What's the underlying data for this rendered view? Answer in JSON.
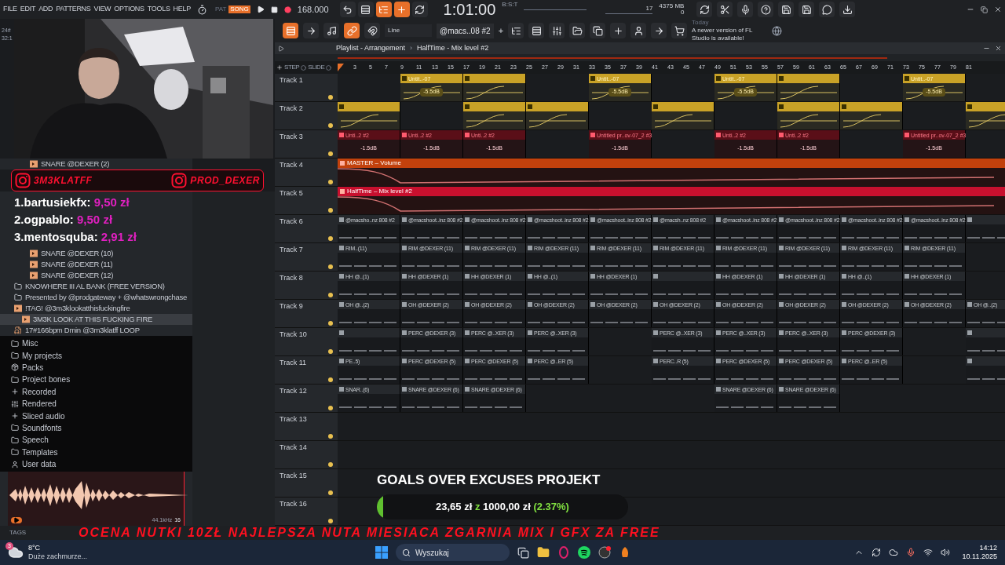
{
  "menu": [
    "FILE",
    "EDIT",
    "ADD",
    "PATTERNS",
    "VIEW",
    "OPTIONS",
    "TOOLS",
    "HELP"
  ],
  "transport": {
    "modes": [
      {
        "label": "PAT",
        "selected": false
      },
      {
        "label": "SONG",
        "selected": true
      }
    ],
    "tempo": "168.000",
    "time": "1:01:00",
    "time_unit": "B:S:T"
  },
  "monitor": {
    "cpu": "17",
    "memory": "4375 MB",
    "polyphony": "0"
  },
  "hint_lines": [
    "24#",
    "32:1"
  ],
  "toolbar": {
    "snap": "Line",
    "pattern": "@macs..08 #2",
    "add": "+",
    "news_day": "Today",
    "news": "A newer version of FL Studio is available!"
  },
  "webcam": {
    "kind": "picture"
  },
  "socials": [
    {
      "handle": "3M3KLATFF"
    },
    {
      "handle": "PROD_DEXER"
    }
  ],
  "donors": [
    {
      "rank": "1.",
      "name": "bartusiekfx:",
      "amount": "9,50 zł"
    },
    {
      "rank": "2.",
      "name": "ogpablo:",
      "amount": "9,50 zł"
    },
    {
      "rank": "3.",
      "name": "mentosquba:",
      "amount": "2,91 zł"
    }
  ],
  "browser": {
    "open_items": [
      {
        "label": "SNARE @DEXER (2)",
        "kind": "sample",
        "selected": false
      },
      {
        "label": "SNARE @DEXER (10)",
        "kind": "sample",
        "selected": false
      },
      {
        "label": "SNARE @DEXER (11)",
        "kind": "sample",
        "selected": false
      },
      {
        "label": "SNARE @DEXER (12)",
        "kind": "sample",
        "selected": false
      },
      {
        "label": "KNOWHERE III AL BANK (FREE VERSION)",
        "kind": "folder",
        "selected": false
      },
      {
        "label": "Presented by @prodgateway + @whatswrongchase",
        "kind": "folder",
        "selected": false
      },
      {
        "label": "!TAG! @3m3klookatthisfuckingfire",
        "kind": "sample",
        "selected": false,
        "children": [
          {
            "label": "3M3K LOOK AT THIS FUCKING FIRE",
            "kind": "sample",
            "selected": true
          }
        ]
      },
      {
        "label": "17#166bpm Dmin @3m3klatff LOOP",
        "kind": "audio",
        "selected": false
      }
    ],
    "roots": [
      {
        "label": "Misc",
        "kind": "folder"
      },
      {
        "label": "My projects",
        "kind": "folder"
      },
      {
        "label": "Packs",
        "kind": "packs"
      },
      {
        "label": "Project bones",
        "kind": "folder"
      },
      {
        "label": "Recorded",
        "kind": "recorded"
      },
      {
        "label": "Rendered",
        "kind": "rendered"
      },
      {
        "label": "Sliced audio",
        "kind": "recorded"
      },
      {
        "label": "Soundfonts",
        "kind": "folder"
      },
      {
        "label": "Speech",
        "kind": "folder"
      },
      {
        "label": "Templates",
        "kind": "folder"
      },
      {
        "label": "User data",
        "kind": "user"
      }
    ],
    "sample_rate": "44.1kHz",
    "bit_depth": "16",
    "tags_label": "TAGS"
  },
  "playlist": {
    "title": "Playlist - Arrangement",
    "separator": "›",
    "pattern": "HalfTime - Mix level #2",
    "step_label": "STEP",
    "slide_label": "SLIDE",
    "ruler": [
      "3",
      "5",
      "7",
      "9",
      "11",
      "13",
      "15",
      "17",
      "19",
      "21",
      "23",
      "25",
      "27",
      "29",
      "31",
      "33",
      "35",
      "37",
      "39",
      "41",
      "43",
      "45",
      "47",
      "49",
      "51",
      "53",
      "55",
      "57",
      "59",
      "61",
      "63",
      "65",
      "67",
      "69",
      "71",
      "73",
      "75",
      "77",
      "79",
      "81"
    ],
    "tracks": [
      {
        "name": "Track 1",
        "clips": [
          {
            "kind": "gap"
          },
          {
            "kind": "melody",
            "label": "Untit..-07",
            "note": "-5.5dB"
          },
          {
            "kind": "melody"
          },
          {
            "kind": "gap"
          },
          {
            "kind": "melody",
            "label": "Untit..-07",
            "note": "-5.5dB"
          },
          {
            "kind": "gap"
          },
          {
            "kind": "melody",
            "label": "Untit..-07",
            "note": "-5.5dB"
          },
          {
            "kind": "melody"
          },
          {
            "kind": "gap"
          },
          {
            "kind": "melody",
            "label": "Untit..-07",
            "note": "-5.5dB"
          }
        ]
      },
      {
        "name": "Track 2",
        "clips": [
          {
            "kind": "melody"
          },
          {
            "kind": "gap"
          },
          {
            "kind": "melody"
          },
          {
            "kind": "melody"
          },
          {
            "kind": "gap"
          },
          {
            "kind": "melody"
          },
          {
            "kind": "gap"
          },
          {
            "kind": "melody"
          },
          {
            "kind": "melody"
          },
          {
            "kind": "gap"
          },
          {
            "kind": "melody"
          }
        ]
      },
      {
        "name": "Track 3",
        "clips": [
          {
            "kind": "audio",
            "label": "Unti..2 #2",
            "note": "-1.5dB"
          },
          {
            "kind": "audio",
            "label": "Unti..2 #2",
            "note": "-1.5dB"
          },
          {
            "kind": "audio",
            "label": "Unti..2 #2",
            "note": "-1.5dB"
          },
          {
            "kind": "gap"
          },
          {
            "kind": "audio",
            "label": "Untitled pr..ov-07_2 #3",
            "note": "-1.5dB"
          },
          {
            "kind": "gap"
          },
          {
            "kind": "audio",
            "label": "Unti..2 #2",
            "note": "-1.5dB"
          },
          {
            "kind": "audio",
            "label": "Unti..2 #2",
            "note": "-1.5dB"
          },
          {
            "kind": "gap"
          },
          {
            "kind": "audio",
            "label": "Untitled pr..ov-07_2 #3",
            "note": "-1.5dB"
          }
        ]
      },
      {
        "name": "Track 4",
        "clips": [
          {
            "kind": "automation",
            "label": "MASTER – Volume",
            "color": "#c2410c"
          }
        ]
      },
      {
        "name": "Track 5",
        "clips": [
          {
            "kind": "automation",
            "label": "HalfTime – Mix level #2",
            "color": "#c8102e"
          }
        ]
      },
      {
        "name": "Track 6",
        "clips": [
          {
            "kind": "drums",
            "label": "@macsho..nz 808 #2"
          },
          {
            "kind": "drums",
            "label": "@macshoot..inz 808 #2"
          },
          {
            "kind": "drums",
            "label": "@macshoot..inz 808 #2"
          },
          {
            "kind": "drums",
            "label": "@macshoot..inz 808 #2"
          },
          {
            "kind": "drums",
            "label": "@macshoot..inz 808 #2"
          },
          {
            "kind": "drums",
            "label": "@macsh..nz 808 #2"
          },
          {
            "kind": "drums",
            "label": "@macshoot..inz 808 #2"
          },
          {
            "kind": "drums",
            "label": "@macshoot..inz 808 #2"
          },
          {
            "kind": "drums",
            "label": "@macshoot..inz 808 #2"
          },
          {
            "kind": "drums",
            "label": "@macshoot..inz 808 #2"
          },
          {
            "kind": "drums"
          }
        ]
      },
      {
        "name": "Track 7",
        "clips": [
          {
            "kind": "drums",
            "label": "RIM..(11)"
          },
          {
            "kind": "drums",
            "label": "RIM @DEXER (11)"
          },
          {
            "kind": "drums",
            "label": "RIM @DEXER (11)"
          },
          {
            "kind": "drums",
            "label": "RIM @DEXER (11)"
          },
          {
            "kind": "drums",
            "label": "RIM @DEXER (11)"
          },
          {
            "kind": "drums",
            "label": "RIM @DEXER (11)"
          },
          {
            "kind": "drums",
            "label": "RIM @DEXER (11)"
          },
          {
            "kind": "drums",
            "label": "RIM @DEXER (11)"
          },
          {
            "kind": "drums",
            "label": "RIM @DEXER (11)"
          },
          {
            "kind": "drums",
            "label": "RIM @DEXER (11)"
          }
        ]
      },
      {
        "name": "Track 8",
        "clips": [
          {
            "kind": "drums",
            "label": "HH @..(1)"
          },
          {
            "kind": "drums",
            "label": "HH @DEXER (1)"
          },
          {
            "kind": "drums",
            "label": "HH @DEXER (1)"
          },
          {
            "kind": "drums",
            "label": "HH @..(1)"
          },
          {
            "kind": "drums",
            "label": "HH @DEXER (1)"
          },
          {
            "kind": "drums"
          },
          {
            "kind": "drums",
            "label": "HH @DEXER (1)"
          },
          {
            "kind": "drums",
            "label": "HH @DEXER (1)"
          },
          {
            "kind": "drums",
            "label": "HH @..(1)"
          },
          {
            "kind": "drums",
            "label": "HH @DEXER (1)"
          }
        ]
      },
      {
        "name": "Track 9",
        "clips": [
          {
            "kind": "drums",
            "label": "OH @..(2)"
          },
          {
            "kind": "drums",
            "label": "OH @DEXER (2)"
          },
          {
            "kind": "drums",
            "label": "OH @DEXER (2)"
          },
          {
            "kind": "drums",
            "label": "OH @DEXER (2)"
          },
          {
            "kind": "drums",
            "label": "OH @DEXER (2)"
          },
          {
            "kind": "drums",
            "label": "OH @DEXER (2)"
          },
          {
            "kind": "drums",
            "label": "OH @DEXER (2)"
          },
          {
            "kind": "drums",
            "label": "OH @DEXER (2)"
          },
          {
            "kind": "drums",
            "label": "OH @DEXER (2)"
          },
          {
            "kind": "drums",
            "label": "OH @DEXER (2)"
          },
          {
            "kind": "drums",
            "label": "OH @..(2)"
          }
        ]
      },
      {
        "name": "Track 10",
        "clips": [
          {
            "kind": "drums"
          },
          {
            "kind": "drums",
            "label": "PERC @DEXER (3)"
          },
          {
            "kind": "drums",
            "label": "PERC @..XER (3)"
          },
          {
            "kind": "drums",
            "label": "PERC @..XER (3)"
          },
          {
            "kind": "gap"
          },
          {
            "kind": "drums",
            "label": "PERC @..XER (3)"
          },
          {
            "kind": "drums",
            "label": "PERC @..XER (3)"
          },
          {
            "kind": "drums",
            "label": "PERC @..XER (3)"
          },
          {
            "kind": "drums",
            "label": "PERC @DEXER (3)"
          },
          {
            "kind": "gap"
          },
          {
            "kind": "drums"
          }
        ]
      },
      {
        "name": "Track 11",
        "clips": [
          {
            "kind": "drums",
            "label": "PE..5)"
          },
          {
            "kind": "drums",
            "label": "PERC @DEXER (5)"
          },
          {
            "kind": "drums",
            "label": "PERC @DEXER (5)"
          },
          {
            "kind": "drums",
            "label": "PERC @..ER (5)"
          },
          {
            "kind": "gap"
          },
          {
            "kind": "drums",
            "label": "PERC..R (5)"
          },
          {
            "kind": "drums",
            "label": "PERC @DEXER (5)"
          },
          {
            "kind": "drums",
            "label": "PERC @DEXER (5)"
          },
          {
            "kind": "drums",
            "label": "PERC @..ER (5)"
          },
          {
            "kind": "gap"
          },
          {
            "kind": "drums"
          }
        ]
      },
      {
        "name": "Track 12",
        "clips": [
          {
            "kind": "drums",
            "label": "SNAR..(6)"
          },
          {
            "kind": "drums",
            "label": "SNARE @DEXER (6)"
          },
          {
            "kind": "drums",
            "label": "SNARE @DEXER (6)"
          },
          {
            "kind": "gap"
          },
          {
            "kind": "gap"
          },
          {
            "kind": "gap"
          },
          {
            "kind": "drums",
            "label": "SNARE @DEXER (6)"
          },
          {
            "kind": "drums",
            "label": "SNARE @DEXER (6)"
          }
        ]
      },
      {
        "name": "Track 13"
      },
      {
        "name": "Track 14"
      },
      {
        "name": "Track 15"
      },
      {
        "name": "Track 16"
      }
    ]
  },
  "goal": {
    "title": "GOALS OVER EXCUSES PROJEKT",
    "raised": "23,65 zł",
    "joiner": "z",
    "target": "1000,00 zł",
    "percent": "(2.37%)",
    "level": 0.0237
  },
  "ticker": "OCENA NUTKI 10ZŁ  NAJLEPSZA NUTA MIESIACA ZGARNIA MIX I GFX ZA FREE",
  "taskbar": {
    "weather_temp": "8°C",
    "weather_desc": "Duże zachmurze...",
    "weather_badge": "3",
    "search": "Wyszukaj",
    "time": "14:12",
    "date": "10.11.2025"
  }
}
